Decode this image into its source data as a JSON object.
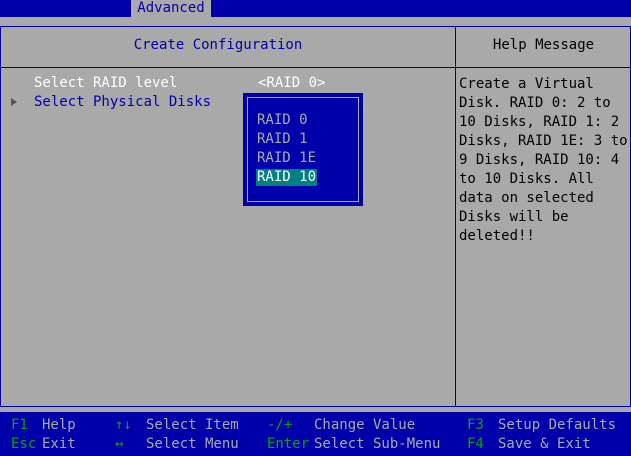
{
  "header": {
    "tab_label": "Advanced"
  },
  "left_panel": {
    "title": "Create Configuration"
  },
  "right_panel": {
    "title": "Help Message"
  },
  "settings": [
    {
      "label": "Select RAID level",
      "value": "<RAID 0>"
    },
    {
      "label": "Select Physical Disks"
    }
  ],
  "popup": {
    "options": [
      "RAID 0",
      "RAID 1",
      "RAID 1E",
      "RAID 10"
    ],
    "selected_index": 3
  },
  "help_text": "Create a Virtual Disk. RAID 0: 2 to 10 Disks, RAID 1: 2 Disks, RAID 1E: 3 to 9 Disks, RAID 10: 4 to 10 Disks. All data on selected Disks will be deleted!!",
  "footer": {
    "row1": [
      {
        "key": "F1",
        "action": "Help"
      },
      {
        "key": "↑↓",
        "action": "Select Item"
      },
      {
        "key": "-/+",
        "action": "Change Value"
      },
      {
        "key": "F3",
        "action": "Setup Defaults"
      }
    ],
    "row2": [
      {
        "key": "Esc",
        "action": "Exit"
      },
      {
        "key": "↔",
        "action": "Select Menu"
      },
      {
        "key": "Enter",
        "action": "Select Sub-Menu"
      },
      {
        "key": "F4",
        "action": "Save & Exit"
      }
    ]
  },
  "colors": {
    "background": "#a9a9a9",
    "bios_blue": "#0000aa",
    "selection": "#008080",
    "key_green": "#00aa00"
  }
}
